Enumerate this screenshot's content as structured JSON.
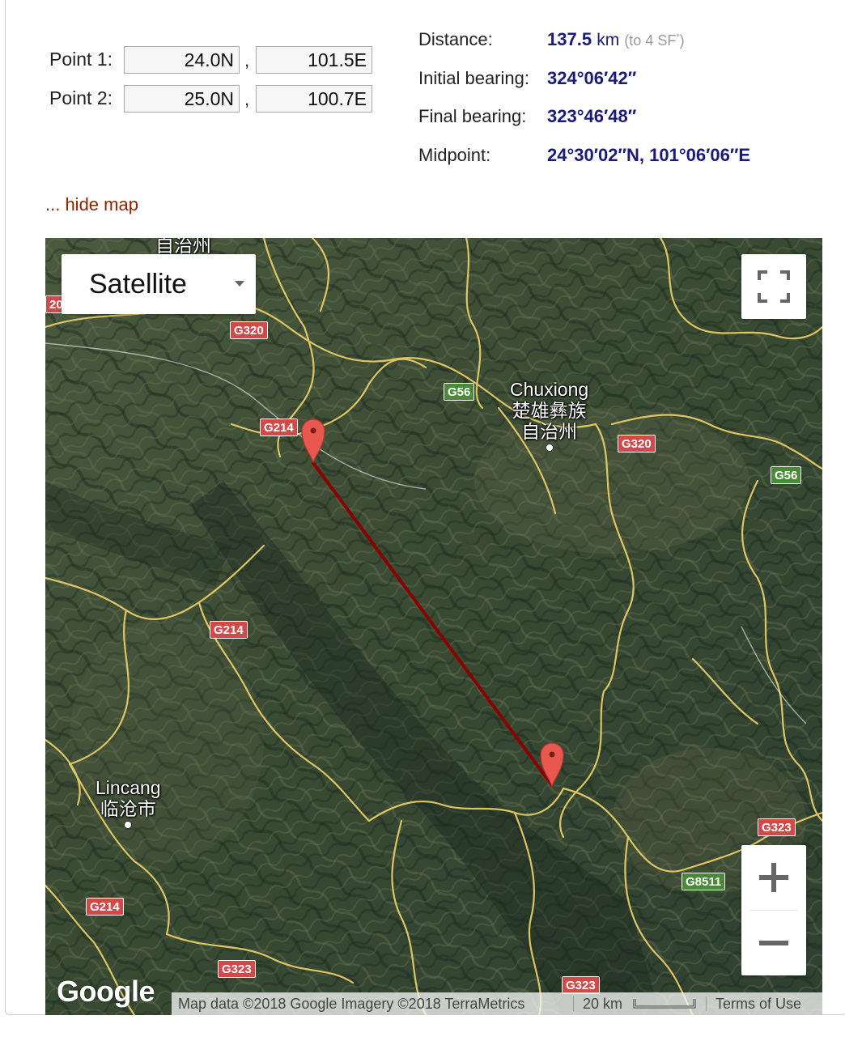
{
  "form": {
    "point1_label": "Point 1:",
    "point2_label": "Point 2:",
    "point1_lat": "24.0N",
    "point1_lon": "101.5E",
    "point2_lat": "25.0N",
    "point2_lon": "100.7E",
    "separator": ","
  },
  "results": {
    "distance_label": "Distance:",
    "distance_value": "137.5",
    "distance_unit": "km",
    "distance_note": "(to 4 SF",
    "distance_note_mark": "*",
    "distance_note_close": ")",
    "initial_bearing_label": "Initial bearing:",
    "initial_bearing_value": "324°06′42″",
    "final_bearing_label": "Final bearing:",
    "final_bearing_value": "323°46′48″",
    "midpoint_label": "Midpoint:",
    "midpoint_value": "24°30′02″N, 101°06′06″E"
  },
  "hide_map_link": "... hide map",
  "map": {
    "map_type": "Satellite",
    "zoom_in_icon": "plus-icon",
    "zoom_out_icon": "minus-icon",
    "fullscreen_icon": "fullscreen-icon",
    "logo": "Google",
    "attribution": "Map data ©2018 Google Imagery ©2018 TerraMetrics",
    "scale_label": "20 km",
    "terms": "Terms of Use",
    "route_color": "#8b0000",
    "marker_color": "#e8584f",
    "cities": {
      "chuxiong_en": "Chuxiong",
      "chuxiong_zh1": "楚雄彝族",
      "chuxiong_zh2": "自治州",
      "lincang_en": "Lincang",
      "lincang_zh": "临沧市",
      "top_partial": "自治州"
    },
    "roads": {
      "g320_a": "G320",
      "g320_b": "G320",
      "g214_a": "G214",
      "g214_b": "G214",
      "g214_c": "G214",
      "g56_a": "G56",
      "g56_b": "G56",
      "g323_a": "G323",
      "g323_b": "G323",
      "g323_c": "G323",
      "g8511": "G8511",
      "partial_20": "20"
    }
  }
}
